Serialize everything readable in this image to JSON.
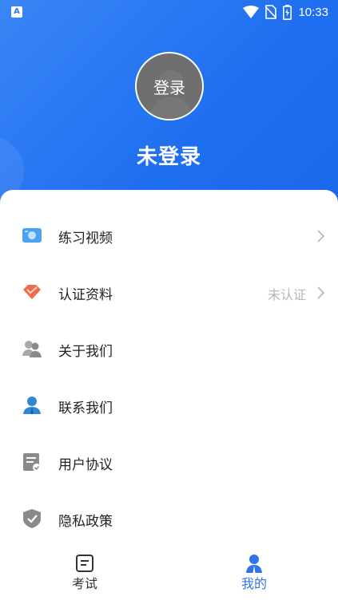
{
  "status_bar": {
    "time": "10:33",
    "app_badge": "A"
  },
  "profile": {
    "avatar_text": "登录",
    "name": "未登录"
  },
  "menu": {
    "items": [
      {
        "label": "练习视频",
        "icon": "video-icon"
      },
      {
        "label": "认证资料",
        "icon": "certificate-icon",
        "value": "未认证"
      },
      {
        "label": "关于我们",
        "icon": "group-icon"
      },
      {
        "label": "联系我们",
        "icon": "contact-icon"
      },
      {
        "label": "用户协议",
        "icon": "agreement-icon"
      },
      {
        "label": "隐私政策",
        "icon": "shield-icon"
      }
    ]
  },
  "tabbar": {
    "tabs": [
      {
        "label": "考试",
        "icon": "exam-icon",
        "active": false
      },
      {
        "label": "我的",
        "icon": "profile-icon",
        "active": true
      }
    ]
  },
  "colors": {
    "primary": "#2f7cf5",
    "active_tab": "#2f74e8",
    "certificate": "#f06b48",
    "video": "#4aa3f0",
    "gray_icon": "#8a8a8a"
  }
}
